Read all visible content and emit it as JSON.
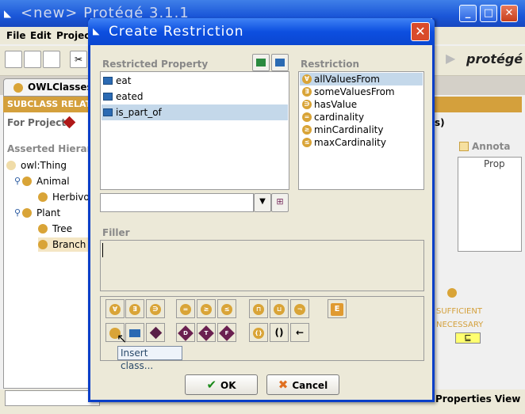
{
  "main": {
    "title": "<new>  Protégé 3.1.1",
    "menus": [
      "File",
      "Edit",
      "Project"
    ],
    "tab_label": "OWLClasses",
    "subclass_bar": "SUBCLASS RELAT",
    "for_project_label": "For Project:",
    "asserted_label": "Asserted Hierarch",
    "tree": [
      {
        "label": "owl:Thing",
        "level": 0,
        "expander": false
      },
      {
        "label": "Animal",
        "level": 1,
        "expander": true
      },
      {
        "label": "Herbivor",
        "level": 2,
        "expander": false
      },
      {
        "label": "Plant",
        "level": 1,
        "expander": true
      },
      {
        "label": "Tree",
        "level": 2,
        "expander": false
      },
      {
        "label": "Branch",
        "level": 2,
        "expander": false,
        "selected": true
      }
    ],
    "right_panel": {
      "logo": "rotégé",
      "annot_label": "Annota",
      "prop_label": "Prop",
      "s_label": "s)",
      "sufficient": "SUFFICIENT",
      "necessary": "NECESSARY",
      "subclass_symbol": "⊑",
      "properties_view": "Properties View"
    }
  },
  "dialog": {
    "title": "Create Restriction",
    "restricted_property_label": "Restricted Property",
    "properties": [
      {
        "label": "eat",
        "selected": false
      },
      {
        "label": "eated",
        "selected": false
      },
      {
        "label": "is_part_of",
        "selected": true
      }
    ],
    "restriction_label": "Restriction",
    "restrictions": [
      {
        "label": "allValuesFrom",
        "symbol": "∀",
        "selected": true
      },
      {
        "label": "someValuesFrom",
        "symbol": "∃",
        "selected": false
      },
      {
        "label": "hasValue",
        "symbol": "∋",
        "selected": false
      },
      {
        "label": "cardinality",
        "symbol": "=",
        "selected": false
      },
      {
        "label": "minCardinality",
        "symbol": "≥",
        "selected": false
      },
      {
        "label": "maxCardinality",
        "symbol": "≤",
        "selected": false
      }
    ],
    "filler_label": "Filler",
    "palette_row1": [
      "∀",
      "∃",
      "∋",
      "=",
      "≥",
      "≤",
      "⊓",
      "⊔",
      "¬",
      "E"
    ],
    "palette_row2": [
      "",
      "",
      "",
      "D",
      "T",
      "F",
      "{}",
      "()",
      "←"
    ],
    "tooltip": "Insert class...",
    "ok_label": "OK",
    "cancel_label": "Cancel"
  },
  "colors": {
    "title_bar": "#1a56d8",
    "accent_gold": "#d4a03c",
    "selection": "#c4d8ea",
    "ok_check": "#1a8a1a",
    "cancel_x": "#e07020"
  }
}
